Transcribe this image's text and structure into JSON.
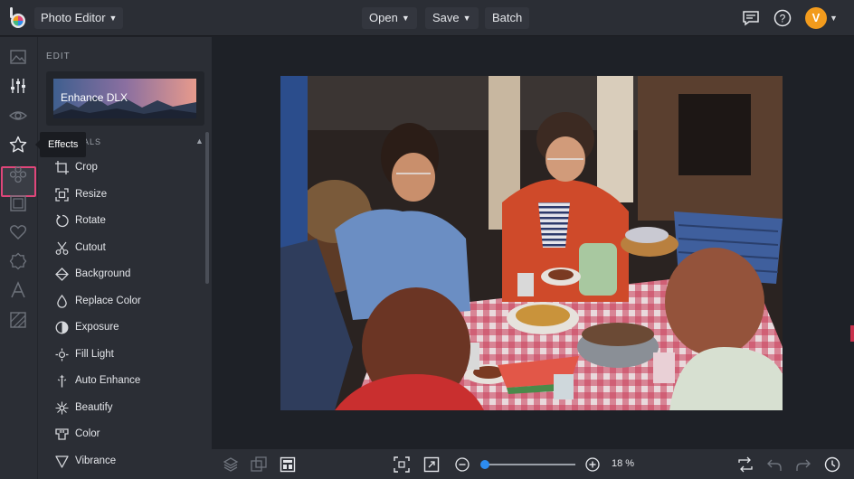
{
  "app": {
    "menu_label": "Photo Editor"
  },
  "toolbar": {
    "open_label": "Open",
    "save_label": "Save",
    "batch_label": "Batch"
  },
  "user": {
    "initial": "V",
    "avatar_color": "#f29b1d"
  },
  "rail": {
    "tooltip": "Effects",
    "icons": [
      "image-icon",
      "sliders-icon",
      "eye-icon",
      "star-icon",
      "flower-icon",
      "frame-icon",
      "heart-icon",
      "badge-icon",
      "text-icon",
      "texture-icon"
    ]
  },
  "panel": {
    "edit_label": "EDIT",
    "enhance_label": "Enhance DLX",
    "section_label": "ALS",
    "items": [
      {
        "label": "Crop",
        "icon": "crop-icon"
      },
      {
        "label": "Resize",
        "icon": "resize-icon"
      },
      {
        "label": "Rotate",
        "icon": "rotate-icon"
      },
      {
        "label": "Cutout",
        "icon": "scissors-icon"
      },
      {
        "label": "Background",
        "icon": "background-icon"
      },
      {
        "label": "Replace Color",
        "icon": "drop-icon"
      },
      {
        "label": "Exposure",
        "icon": "exposure-icon"
      },
      {
        "label": "Fill Light",
        "icon": "sun-icon"
      },
      {
        "label": "Auto Enhance",
        "icon": "magic-wand-icon"
      },
      {
        "label": "Beautify",
        "icon": "sparkle-icon"
      },
      {
        "label": "Color",
        "icon": "color-icon"
      },
      {
        "label": "Vibrance",
        "icon": "triangle-icon"
      }
    ]
  },
  "bottom": {
    "zoom_text": "18 %",
    "zoom_fraction": 0.0
  },
  "colors": {
    "accent": "#2d8cf0",
    "active_highlight": "#e0467a",
    "panel_bg": "#2b2e35",
    "canvas_bg": "#1e2127"
  }
}
